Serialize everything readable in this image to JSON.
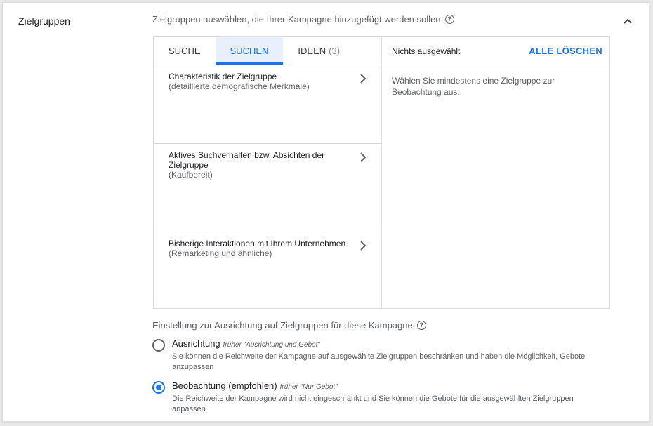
{
  "section": {
    "title": "Zielgruppen",
    "description": "Zielgruppen auswählen, die Ihrer Kampagne hinzugefügt werden sollen"
  },
  "tabs": [
    {
      "label": "SUCHE",
      "active": false
    },
    {
      "label": "SUCHEN",
      "active": true
    },
    {
      "label": "IDEEN",
      "count": "(3)",
      "active": false
    }
  ],
  "categories": [
    {
      "title": "Charakteristik der Zielgruppe",
      "subtitle": "(detaillierte demografische Merkmale)"
    },
    {
      "title": "Aktives Suchverhalten bzw. Absichten der Zielgruppe",
      "subtitle": "(Kaufbereit)"
    },
    {
      "title": "Bisherige Interaktionen mit Ihrem Unternehmen",
      "subtitle": "(Remarketing und ähnliche)"
    }
  ],
  "selection": {
    "status": "Nichts ausgewählt",
    "clear_all": "ALLE LÖSCHEN",
    "hint": "Wählen Sie mindestens eine Zielgruppe zur Beobachtung aus."
  },
  "targeting": {
    "label": "Einstellung zur Ausrichtung auf Zielgruppen für diese Kampagne",
    "options": [
      {
        "title": "Ausrichtung",
        "former": "früher \"Ausrichtung und Gebot\"",
        "description": "Sie können die Reichweite der Kampagne auf ausgewählte Zielgruppen beschränken und haben die Möglichkeit, Gebote anzupassen",
        "selected": false
      },
      {
        "title": "Beobachtung (empfohlen)",
        "former": "früher \"Nur Gebot\"",
        "description": "Die Reichweite der Kampagne wird nicht eingeschränkt und Sie können die Gebote für die ausgewählten Zielgruppen anpassen",
        "selected": true
      }
    ]
  },
  "icons": {
    "help": "help-circle-icon",
    "collapse": "chevron-up-icon",
    "expand_category": "chevron-right-icon"
  },
  "colors": {
    "accent": "#1a73e8",
    "active_tab_bg": "#e8f0fe",
    "border": "#dadce0",
    "secondary_text": "#5f6368"
  }
}
